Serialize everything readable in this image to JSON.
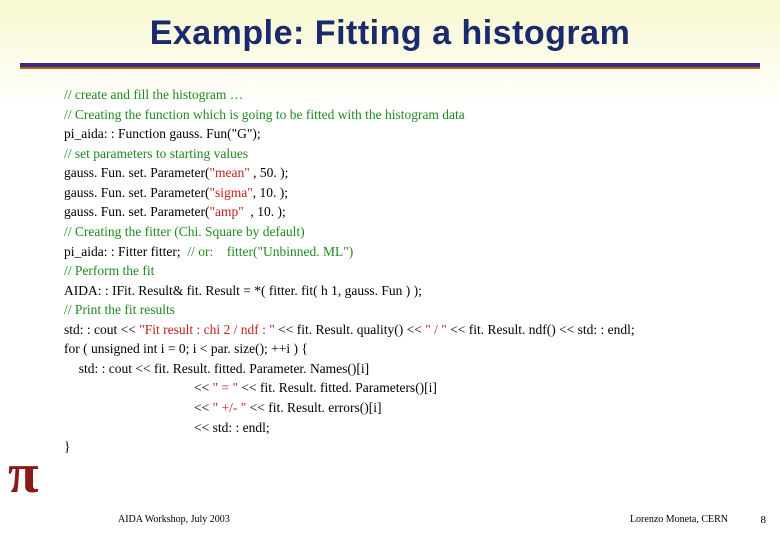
{
  "title": "Example: Fitting a histogram",
  "code": {
    "l01": "// create and fill the histogram …",
    "l02": "// Creating the function which is going to be fitted with the histogram data",
    "l03": "pi_aida: : Function gauss. Fun(\"G\");",
    "l04": "// set parameters to starting values",
    "l05a": "gauss. Fun. set. Parameter(",
    "l05b": "\"mean\"",
    "l05c": " , 50. );",
    "l06a": "gauss. Fun. set. Parameter(",
    "l06b": "\"sigma\"",
    "l06c": ", 10. );",
    "l07a": "gauss. Fun. set. Parameter(",
    "l07b": "\"amp\"",
    "l07c": "  , 10. );",
    "l08": "// Creating the fitter (Chi. Square by default)",
    "l09a": "pi_aida: : Fitter fitter;  ",
    "l09b": "// or:    fitter(\"Unbinned. ML\")",
    "l10": "// Perform the fit",
    "l11": "AIDA: : IFit. Result& fit. Result = *( fitter. fit( h 1, gauss. Fun ) );",
    "l12": "// Print the fit results",
    "l13a": "std: : cout << ",
    "l13b": "\"Fit result : chi 2 / ndf : \"",
    "l13c": " << fit. Result. quality() << ",
    "l13d": "\" / \"",
    "l13e": " << fit. Result. ndf() << std: : endl;",
    "l14": "for ( unsigned int i = 0; i < par. size(); ++i ) {",
    "l15": "  std: : cout << fit. Result. fitted. Parameter. Names()[i]",
    "l16a": "<< ",
    "l16b": "\" = \"",
    "l16c": " << fit. Result. fitted. Parameters()[i]",
    "l17a": "<< ",
    "l17b": "\" +/- \"",
    "l17c": " << fit. Result. errors()[i]",
    "l18": "<< std: : endl;",
    "l19": "}"
  },
  "pi_symbol": "π",
  "footer": {
    "left": "AIDA Workshop, July 2003",
    "right1": "Lorenzo Moneta, CERN",
    "right2": "8"
  }
}
